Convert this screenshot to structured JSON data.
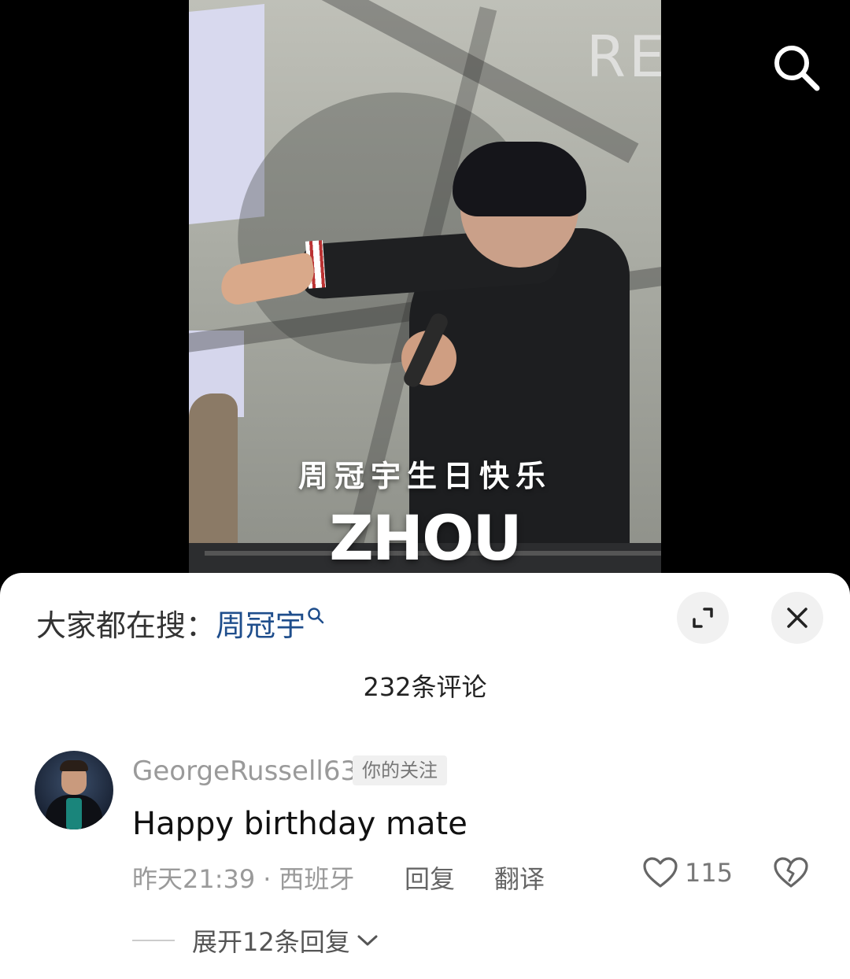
{
  "video": {
    "caption_cn": "周冠宇生日快乐",
    "caption_en": "ZHOU",
    "background_sign_text": "RE"
  },
  "icons": {
    "search": "search-icon",
    "expand": "expand-icon",
    "close": "close-icon",
    "trending_search": "search-small-icon",
    "like": "heart-icon",
    "dislike": "broken-heart-icon",
    "chevron": "chevron-down-icon"
  },
  "sheet": {
    "trending_prefix": "大家都在搜：",
    "trending_term": "周冠宇",
    "comment_count_label": "232条评论"
  },
  "comments": [
    {
      "username": "GeorgeRussell63",
      "badge": "你的关注",
      "text": "Happy birthday mate",
      "time": "昨天21:39",
      "location": "西班牙",
      "reply_label": "回复",
      "translate_label": "翻译",
      "likes": "115",
      "expand_replies_label": "展开12条回复"
    }
  ],
  "colors": {
    "link_blue": "#1f4e8c",
    "secondary_text": "#9a9a9a",
    "sheet_bg": "#ffffff"
  }
}
